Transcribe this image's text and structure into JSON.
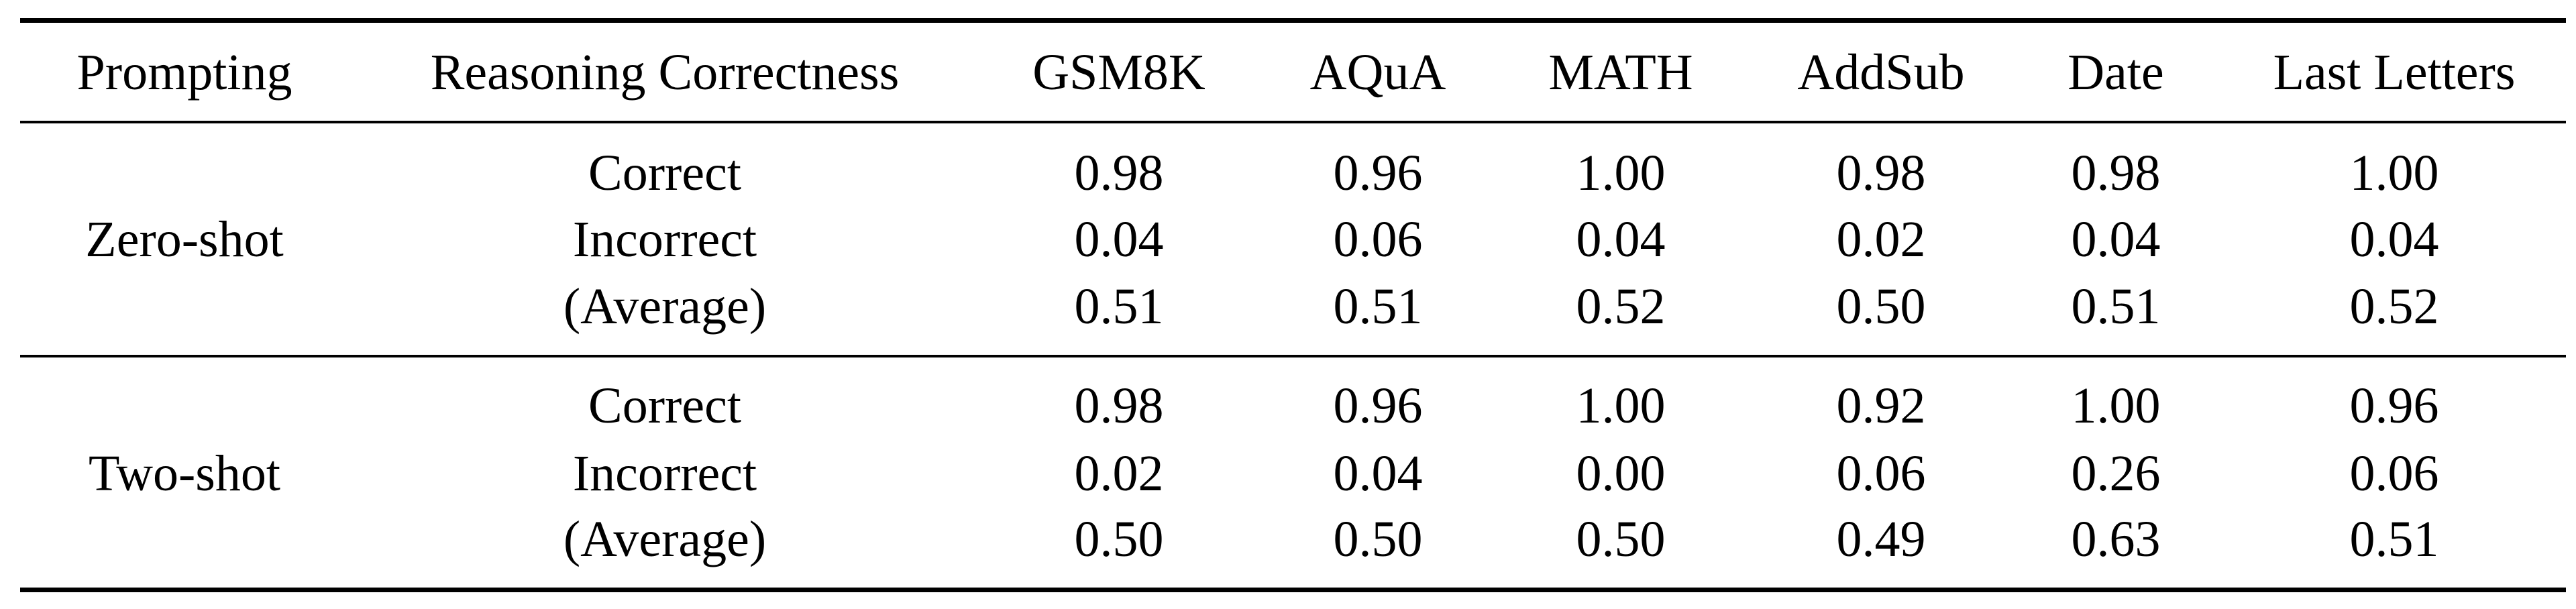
{
  "table": {
    "headers": [
      "Prompting",
      "Reasoning Correctness",
      "GSM8K",
      "AQuA",
      "MATH",
      "AddSub",
      "Date",
      "Last Letters"
    ],
    "groups": [
      {
        "prompting": "Zero-shot",
        "rows": [
          {
            "correctness": "Correct",
            "values": [
              "0.98",
              "0.96",
              "1.00",
              "0.98",
              "0.98",
              "1.00"
            ]
          },
          {
            "correctness": "Incorrect",
            "values": [
              "0.04",
              "0.06",
              "0.04",
              "0.02",
              "0.04",
              "0.04"
            ]
          },
          {
            "correctness": "(Average)",
            "values": [
              "0.51",
              "0.51",
              "0.52",
              "0.50",
              "0.51",
              "0.52"
            ]
          }
        ]
      },
      {
        "prompting": "Two-shot",
        "rows": [
          {
            "correctness": "Correct",
            "values": [
              "0.98",
              "0.96",
              "1.00",
              "0.92",
              "1.00",
              "0.96"
            ]
          },
          {
            "correctness": "Incorrect",
            "values": [
              "0.02",
              "0.04",
              "0.00",
              "0.06",
              "0.26",
              "0.06"
            ]
          },
          {
            "correctness": "(Average)",
            "values": [
              "0.50",
              "0.50",
              "0.50",
              "0.49",
              "0.63",
              "0.51"
            ]
          }
        ]
      }
    ]
  }
}
